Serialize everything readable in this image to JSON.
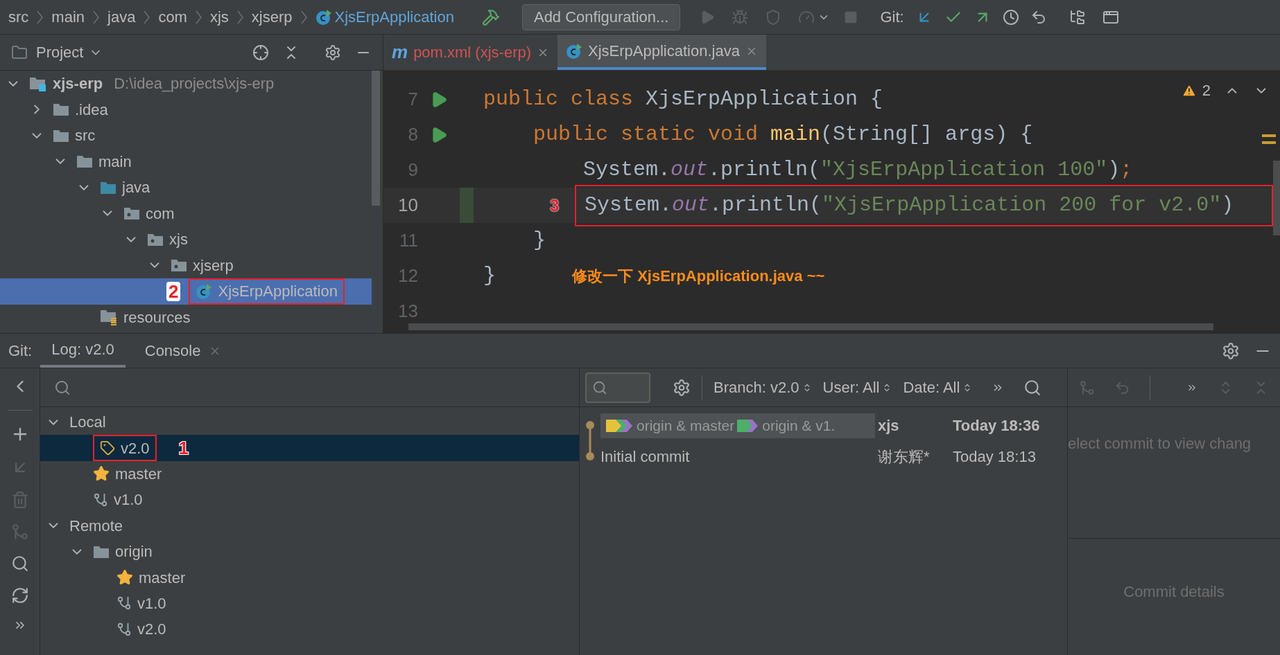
{
  "breadcrumbs": [
    {
      "label": "src",
      "kind": "folder"
    },
    {
      "label": "main",
      "kind": "folder"
    },
    {
      "label": "java",
      "kind": "folder"
    },
    {
      "label": "com",
      "kind": "folder"
    },
    {
      "label": "xjs",
      "kind": "folder"
    },
    {
      "label": "xjserp",
      "kind": "folder"
    },
    {
      "label": "XjsErpApplication",
      "kind": "class"
    }
  ],
  "run_config": "Add Configuration...",
  "vcs_label": "Git:",
  "project_panel": {
    "title": "Project",
    "tree": [
      {
        "label": "xjs-erp",
        "kind": "module",
        "path": "D:\\idea_projects\\xjs-erp",
        "expanded": true,
        "selected": false,
        "children": [
          {
            "label": ".idea",
            "kind": "folder",
            "expanded": false,
            "selected": false
          },
          {
            "label": "src",
            "kind": "folder",
            "expanded": true,
            "selected": false,
            "children": [
              {
                "label": "main",
                "kind": "folder",
                "expanded": true,
                "selected": false,
                "children": [
                  {
                    "label": "java",
                    "kind": "source_folder",
                    "expanded": true,
                    "selected": false,
                    "children": [
                      {
                        "label": "com",
                        "kind": "package",
                        "expanded": true,
                        "selected": false,
                        "children": [
                          {
                            "label": "xjs",
                            "kind": "package",
                            "expanded": true,
                            "selected": false,
                            "children": [
                              {
                                "label": "xjserp",
                                "kind": "package",
                                "expanded": true,
                                "selected": false,
                                "children": [
                                  {
                                    "label": "XjsErpApplication",
                                    "kind": "class",
                                    "selected": true,
                                    "marker": "2"
                                  }
                                ]
                              }
                            ]
                          }
                        ]
                      }
                    ]
                  },
                  {
                    "label": "resources",
                    "kind": "resources",
                    "selected": false
                  }
                ]
              }
            ]
          }
        ]
      }
    ]
  },
  "editor_tabs": [
    {
      "label": "pom.xml (xjs-erp)",
      "kind": "maven",
      "icon": "m",
      "selected": false
    },
    {
      "label": "XjsErpApplication.java",
      "kind": "class",
      "selected": true
    }
  ],
  "editor": {
    "warnings": "2",
    "lines": [
      {
        "number": "7",
        "run": true,
        "current": false,
        "tokens": [
          {
            "kind": "keyword",
            "text": "public class "
          },
          {
            "kind": "plain",
            "text": "XjsErpApplication {"
          }
        ]
      },
      {
        "number": "8",
        "run": true,
        "current": false,
        "tokens": [
          {
            "kind": "keyword",
            "text": "    public static void "
          },
          {
            "kind": "method",
            "text": "main"
          },
          {
            "kind": "plain",
            "text": "(String[] args) {"
          }
        ]
      },
      {
        "number": "9",
        "run": false,
        "current": false,
        "tokens": [
          {
            "kind": "plain",
            "text": "        System."
          },
          {
            "kind": "field",
            "text": "out"
          },
          {
            "kind": "plain",
            "text": ".println("
          },
          {
            "kind": "string",
            "text": "\"XjsErpApplication 100\""
          },
          {
            "kind": "plain",
            "text": ")"
          },
          {
            "kind": "keyword",
            "text": ";"
          }
        ]
      },
      {
        "number": "10",
        "run": false,
        "current": true,
        "marker": "3",
        "tokens": [
          {
            "kind": "plain",
            "text": "        System."
          },
          {
            "kind": "field",
            "text": "out"
          },
          {
            "kind": "plain",
            "text": ".println("
          },
          {
            "kind": "string",
            "text": "\"XjsErpApplication 200 for v2.0\""
          },
          {
            "kind": "plain",
            "text": ")"
          }
        ]
      },
      {
        "number": "11",
        "run": false,
        "current": false,
        "tokens": [
          {
            "kind": "plain",
            "text": "    }"
          }
        ]
      },
      {
        "number": "12",
        "run": false,
        "current": false,
        "tokens": [
          {
            "kind": "plain",
            "text": "}"
          }
        ],
        "note": "修改一下 XjsErpApplication.java ~~"
      },
      {
        "number": "13",
        "run": false,
        "current": false
      }
    ]
  },
  "git_panel": {
    "label": "Git:",
    "tabs": [
      {
        "label": "Log: v2.0",
        "selected": true,
        "closable": false
      },
      {
        "label": "Console",
        "selected": false,
        "closable": true
      }
    ],
    "branches": [
      {
        "label": "Local",
        "expanded": true,
        "selected": false,
        "children": [
          {
            "label": "v2.0",
            "kind": "tag",
            "selected": true,
            "marker": "1"
          },
          {
            "label": "master",
            "kind": "favorite",
            "selected": false
          },
          {
            "label": "v1.0",
            "kind": "branch",
            "selected": false
          }
        ]
      },
      {
        "label": "Remote",
        "expanded": true,
        "selected": false,
        "children": [
          {
            "label": "origin",
            "kind": "folder",
            "expanded": true,
            "selected": false,
            "children": [
              {
                "label": "master",
                "kind": "favorite",
                "selected": false
              },
              {
                "label": "v1.0",
                "kind": "branch",
                "selected": false
              },
              {
                "label": "v2.0",
                "kind": "branch",
                "selected": false
              }
            ]
          }
        ]
      }
    ],
    "filters": [
      "Branch: v2.0",
      "User: All",
      "Date: All"
    ],
    "commits": [
      {
        "refs": [
          {
            "label": "origin & master",
            "tags": [
              {
                "color": "#e6c23a"
              },
              {
                "color": "#4caf6a"
              },
              {
                "color": "#9b72c9"
              }
            ]
          },
          {
            "label": "origin & v1.",
            "tags": [
              {
                "color": "#4caf6a"
              },
              {
                "color": "#9b72c9"
              }
            ]
          }
        ],
        "author": "xjs",
        "date": "Today 18:36",
        "bold": true
      },
      {
        "message": "Initial commit",
        "author": "谢东辉*",
        "date": "Today 18:13",
        "bold": false
      }
    ],
    "changes_hint": "elect commit to view chang",
    "details_hint": "Commit details"
  }
}
